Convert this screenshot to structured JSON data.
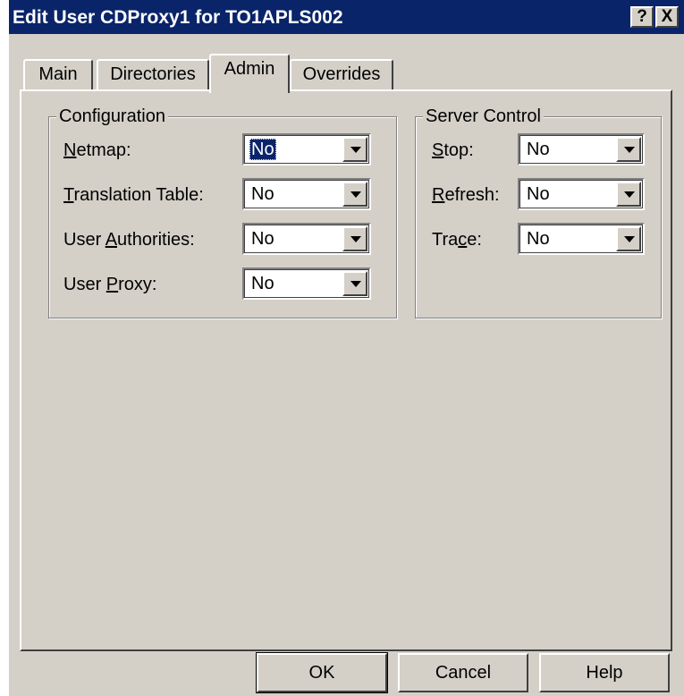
{
  "window": {
    "title": "Edit User CDProxy1 for TO1APLS002",
    "help_glyph": "?",
    "close_glyph": "X"
  },
  "tabs": [
    {
      "label": "Main"
    },
    {
      "label": "Directories"
    },
    {
      "label": "Admin"
    },
    {
      "label": "Overrides"
    }
  ],
  "configuration": {
    "title": "Configuration",
    "fields": [
      {
        "label_pre": "",
        "label_u": "N",
        "label_post": "etmap:",
        "value": "No"
      },
      {
        "label_pre": "",
        "label_u": "T",
        "label_post": "ranslation Table:",
        "value": "No"
      },
      {
        "label_pre": "User ",
        "label_u": "A",
        "label_post": "uthorities:",
        "value": "No"
      },
      {
        "label_pre": "User ",
        "label_u": "P",
        "label_post": "roxy:",
        "value": "No"
      }
    ]
  },
  "server_control": {
    "title": "Server Control",
    "fields": [
      {
        "label_pre": "",
        "label_u": "S",
        "label_post": "top:",
        "value": "No"
      },
      {
        "label_pre": "",
        "label_u": "R",
        "label_post": "efresh:",
        "value": "No"
      },
      {
        "label_pre": "Tra",
        "label_u": "c",
        "label_post": "e:",
        "value": "No"
      }
    ]
  },
  "buttons": {
    "ok": "OK",
    "cancel": "Cancel",
    "help": "Help"
  },
  "colors": {
    "titlebar": "#0a246a",
    "face": "#d4d0c8",
    "selection": "#0a246a"
  }
}
